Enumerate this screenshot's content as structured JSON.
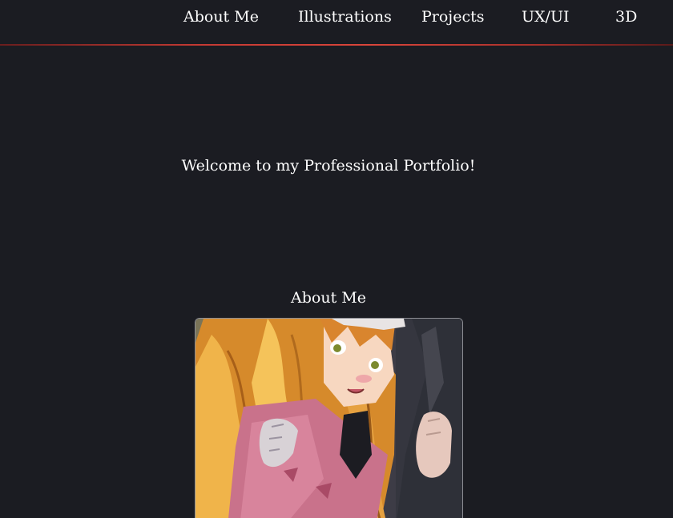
{
  "nav": {
    "items": [
      "About Me",
      "Illustrations",
      "Projects",
      "UX/UI",
      "3D"
    ],
    "accent_color": "#d9453a"
  },
  "hero": {
    "welcome_text": "Welcome to my Professional Portfolio!"
  },
  "about": {
    "title": "About Me",
    "image_subject": "watercolor illustration of an anime girl with long golden hair in a pink sweater, held by gloved hands"
  },
  "colors": {
    "background": "#1b1c22",
    "text": "#ffffff"
  }
}
